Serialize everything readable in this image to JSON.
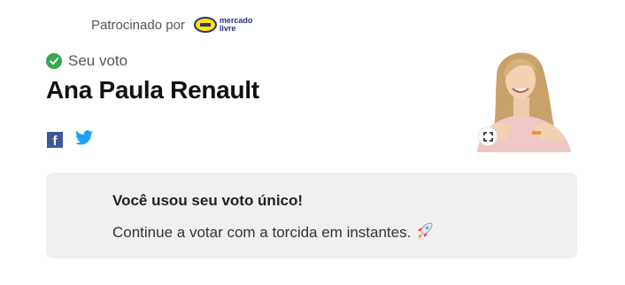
{
  "sponsor": {
    "label": "Patrocinado por",
    "logo_line1": "mercado",
    "logo_line2": "livre",
    "logo_colors": {
      "yellow": "#ffe600",
      "navy": "#2d3277"
    }
  },
  "vote": {
    "status_label": "Seu voto",
    "status_icon": "check-circle-icon",
    "status_color": "#34a853",
    "candidate_name": "Ana Paula Renault"
  },
  "share": {
    "facebook_icon": "facebook-icon",
    "facebook_color": "#3b5998",
    "twitter_icon": "twitter-icon",
    "twitter_color": "#1da1f2"
  },
  "photo": {
    "expand_icon": "expand-icon"
  },
  "message": {
    "title": "Você usou seu voto único!",
    "body": "Continue a votar com a torcida em instantes.",
    "emoji_icon": "rocket-icon"
  }
}
